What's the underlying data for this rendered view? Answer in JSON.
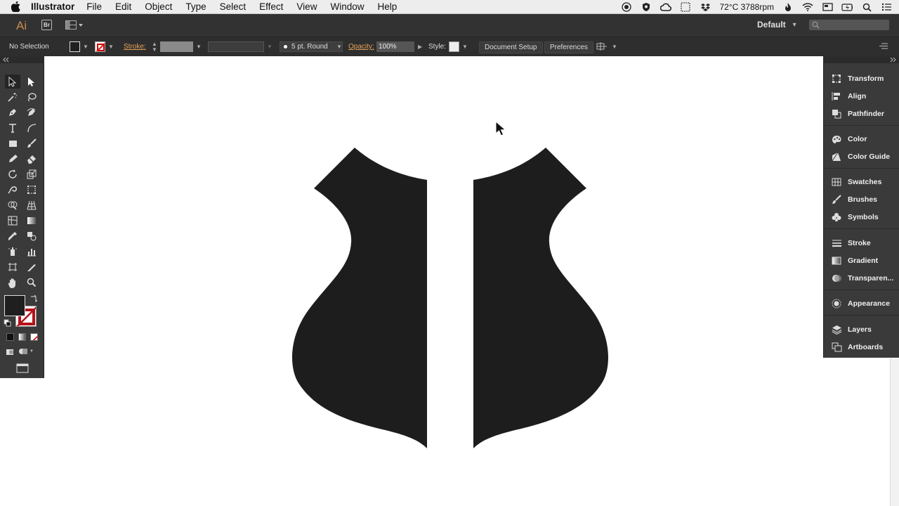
{
  "menubar": {
    "app_name": "Illustrator",
    "menus": [
      "File",
      "Edit",
      "Object",
      "Type",
      "Select",
      "Effect",
      "View",
      "Window",
      "Help"
    ],
    "status_text": "72°C 3788rpm"
  },
  "appbar": {
    "logo": "Ai",
    "bridge_label": "Br",
    "workspace": "Default",
    "search_placeholder": ""
  },
  "controlbar": {
    "selection": "No Selection",
    "stroke_label": "Stroke:",
    "brush": "5 pt. Round",
    "opacity_label": "Opacity:",
    "opacity_value": "100%",
    "style_label": "Style:",
    "document_setup": "Document Setup",
    "preferences": "Preferences"
  },
  "dock": {
    "items": [
      "Transform",
      "Align",
      "Pathfinder",
      "Color",
      "Color Guide",
      "Swatches",
      "Brushes",
      "Symbols",
      "Stroke",
      "Gradient",
      "Transparen...",
      "Appearance",
      "Layers",
      "Artboards"
    ]
  },
  "colors": {
    "accent": "#e6a15a",
    "artwork": "#1d1d1d",
    "panel_bg": "#3a3a3a"
  }
}
